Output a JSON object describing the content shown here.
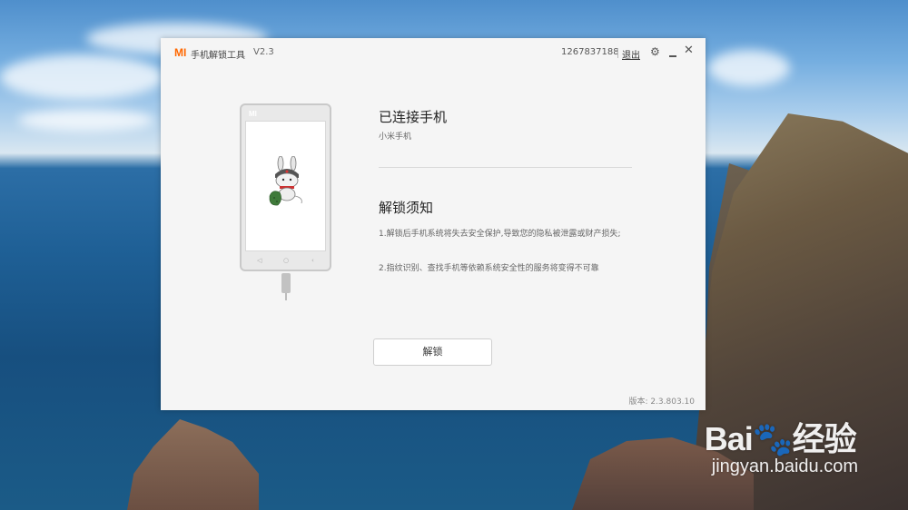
{
  "window": {
    "logo": "MI",
    "title": "手机解锁工具",
    "version": "V2.3",
    "account_id": "1267837188",
    "logout_label": "退出",
    "icons": [
      "gear-icon",
      "minimize-icon",
      "close-icon"
    ]
  },
  "phone": {
    "brand": "MI",
    "nav_buttons": [
      "◁",
      "○",
      "‹"
    ]
  },
  "connection": {
    "title": "已连接手机",
    "device": "小米手机"
  },
  "notice": {
    "title": "解锁须知",
    "items": [
      "1.解锁后手机系统将失去安全保护,导致您的隐私被泄露或财产损失;",
      "2.指纹识别、查找手机等依赖系统安全性的服务将变得不可靠"
    ]
  },
  "actions": {
    "unlock_label": "解锁"
  },
  "footer": {
    "version_text": "版本: 2.3.803.10"
  },
  "watermark": {
    "logo": "Bai🐾经验",
    "url": "jingyan.baidu.com"
  },
  "colors": {
    "brand_orange": "#ff6700",
    "window_bg": "#f5f5f5"
  }
}
